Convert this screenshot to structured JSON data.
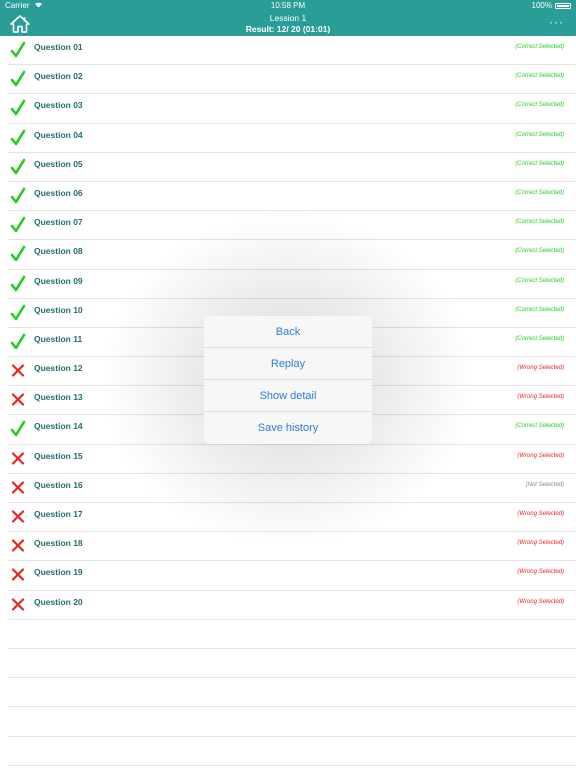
{
  "status_bar": {
    "carrier": "Carrier",
    "time": "10:58 PM",
    "battery": "100%"
  },
  "header": {
    "title": "Lession 1",
    "result": "Result: 12/ 20 (01:01)",
    "more_label": "···",
    "home_icon": "home-icon"
  },
  "colors": {
    "header_bg": "#2a9d98",
    "correct": "#22cc22",
    "wrong": "#e8241e",
    "not_selected": "#888888",
    "question_text": "#1f6f6b",
    "menu_text": "#2a7fd4"
  },
  "questions": [
    {
      "label": "Question 01",
      "result": "correct",
      "status": "(Correct Selected)"
    },
    {
      "label": "Question 02",
      "result": "correct",
      "status": "(Correct Selected)"
    },
    {
      "label": "Question 03",
      "result": "correct",
      "status": "(Correct Selected)"
    },
    {
      "label": "Question 04",
      "result": "correct",
      "status": "(Correct Selected)"
    },
    {
      "label": "Question 05",
      "result": "correct",
      "status": "(Correct Selected)"
    },
    {
      "label": "Question 06",
      "result": "correct",
      "status": "(Correct Selected)"
    },
    {
      "label": "Question 07",
      "result": "correct",
      "status": "(Correct Selected)"
    },
    {
      "label": "Question 08",
      "result": "correct",
      "status": "(Correct Selected)"
    },
    {
      "label": "Question 09",
      "result": "correct",
      "status": "(Correct Selected)"
    },
    {
      "label": "Question 10",
      "result": "correct",
      "status": "(Correct Selected)"
    },
    {
      "label": "Question 11",
      "result": "correct",
      "status": "(Correct Selected)"
    },
    {
      "label": "Question 12",
      "result": "wrong",
      "status": "(Wrong Selected)"
    },
    {
      "label": "Question 13",
      "result": "wrong",
      "status": "(Wrong Selected)"
    },
    {
      "label": "Question 14",
      "result": "correct",
      "status": "(Correct Selected)"
    },
    {
      "label": "Question 15",
      "result": "wrong",
      "status": "(Wrong Selected)"
    },
    {
      "label": "Question 16",
      "result": "wrong",
      "status": "(Not Selected)"
    },
    {
      "label": "Question 17",
      "result": "wrong",
      "status": "(Wrong Selected)"
    },
    {
      "label": "Question 18",
      "result": "wrong",
      "status": "(Wrong Selected)"
    },
    {
      "label": "Question 19",
      "result": "wrong",
      "status": "(Wrong Selected)"
    },
    {
      "label": "Question 20",
      "result": "wrong",
      "status": "(Wrong Selected)"
    }
  ],
  "action_menu": {
    "items": [
      {
        "label": "Back"
      },
      {
        "label": "Replay"
      },
      {
        "label": "Show detail"
      },
      {
        "label": "Save history"
      }
    ]
  }
}
